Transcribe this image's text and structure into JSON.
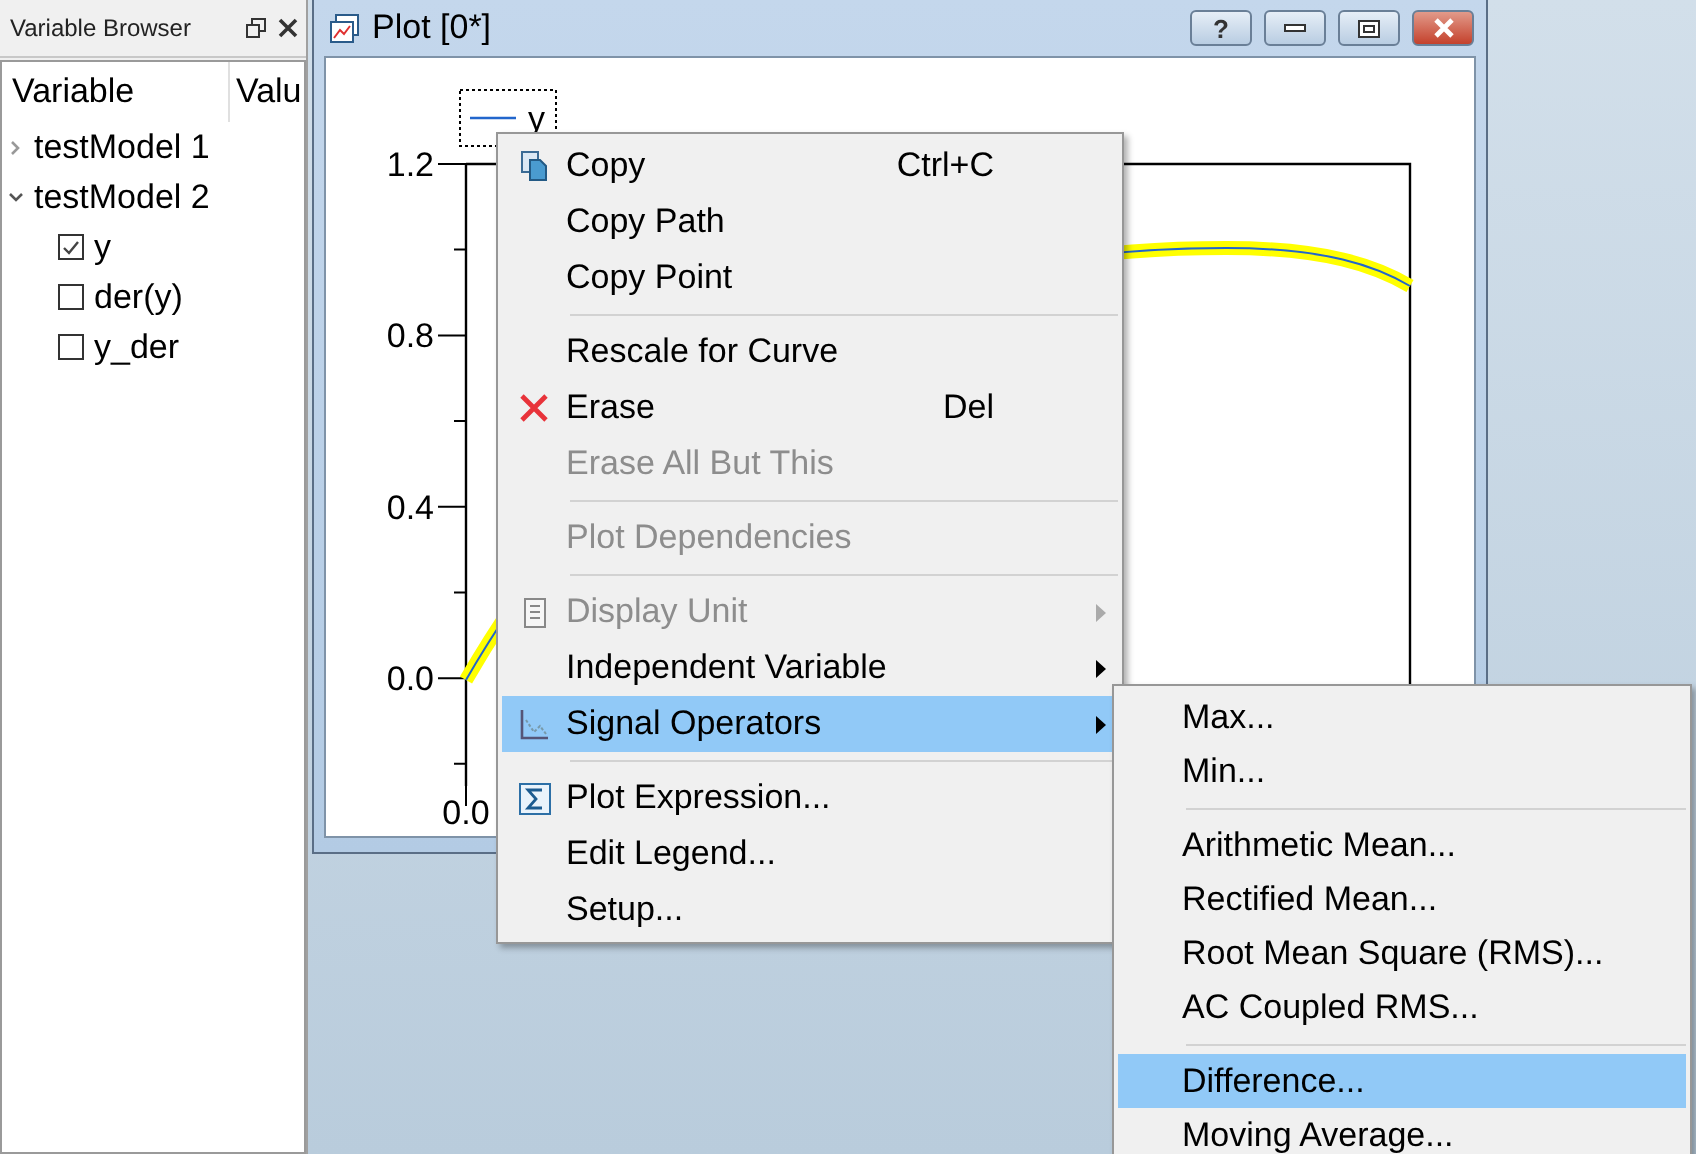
{
  "variable_browser": {
    "title": "Variable Browser",
    "columns": [
      "Variable",
      "Valu"
    ],
    "tree": [
      {
        "label": "testModel 1",
        "expanded": false
      },
      {
        "label": "testModel 2",
        "expanded": true,
        "children": [
          {
            "label": "y",
            "checked": true
          },
          {
            "label": "der(y)",
            "checked": false
          },
          {
            "label": "y_der",
            "checked": false
          }
        ]
      }
    ]
  },
  "plot_window": {
    "title": "Plot [0*]",
    "help_label": "?"
  },
  "plot": {
    "legend": "y",
    "y_ticks": [
      "1.2",
      "0.8",
      "0.4",
      "0.0"
    ],
    "x_ticks": [
      "0.0"
    ]
  },
  "context_menu": {
    "items": [
      {
        "kind": "item",
        "label": "Copy",
        "shortcut": "Ctrl+C",
        "disabled": false,
        "selected": false,
        "submenu": false
      },
      {
        "kind": "item",
        "label": "Copy Path",
        "disabled": false,
        "selected": false,
        "submenu": false
      },
      {
        "kind": "item",
        "label": "Copy Point",
        "disabled": false,
        "selected": false,
        "submenu": false
      },
      {
        "kind": "separator"
      },
      {
        "kind": "item",
        "label": "Rescale for Curve",
        "disabled": false,
        "selected": false,
        "submenu": false
      },
      {
        "kind": "item",
        "label": "Erase",
        "shortcut": "Del",
        "disabled": false,
        "selected": false,
        "submenu": false
      },
      {
        "kind": "item",
        "label": "Erase All But This",
        "disabled": true,
        "selected": false,
        "submenu": false
      },
      {
        "kind": "separator"
      },
      {
        "kind": "item",
        "label": "Plot Dependencies",
        "disabled": true,
        "selected": false,
        "submenu": false
      },
      {
        "kind": "separator"
      },
      {
        "kind": "item",
        "label": "Display Unit",
        "disabled": true,
        "selected": false,
        "submenu": true
      },
      {
        "kind": "item",
        "label": "Independent Variable",
        "disabled": false,
        "selected": false,
        "submenu": true
      },
      {
        "kind": "item",
        "label": "Signal Operators",
        "disabled": false,
        "selected": true,
        "submenu": true
      },
      {
        "kind": "separator"
      },
      {
        "kind": "item",
        "label": "Plot Expression...",
        "disabled": false,
        "selected": false,
        "submenu": false
      },
      {
        "kind": "item",
        "label": "Edit Legend...",
        "disabled": false,
        "selected": false,
        "submenu": false
      },
      {
        "kind": "item",
        "label": "Setup...",
        "disabled": false,
        "selected": false,
        "submenu": false
      }
    ]
  },
  "submenu": {
    "items": [
      {
        "kind": "item",
        "label": "Max...",
        "selected": false
      },
      {
        "kind": "item",
        "label": "Min...",
        "selected": false
      },
      {
        "kind": "separator"
      },
      {
        "kind": "item",
        "label": "Arithmetic Mean...",
        "selected": false
      },
      {
        "kind": "item",
        "label": "Rectified Mean...",
        "selected": false
      },
      {
        "kind": "item",
        "label": "Root Mean Square (RMS)...",
        "selected": false
      },
      {
        "kind": "item",
        "label": "AC Coupled RMS...",
        "selected": false
      },
      {
        "kind": "separator"
      },
      {
        "kind": "item",
        "label": "Difference...",
        "selected": true
      },
      {
        "kind": "item",
        "label": "Moving Average...",
        "selected": false
      }
    ]
  }
}
